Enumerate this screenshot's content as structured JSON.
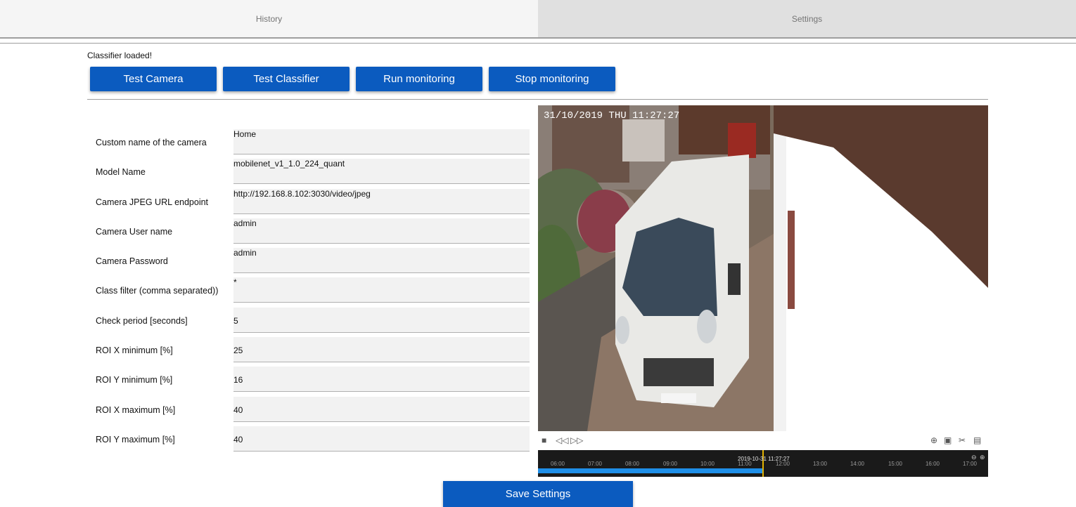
{
  "tabs": {
    "history": "History",
    "settings": "Settings"
  },
  "status": "Classifier loaded!",
  "buttons": {
    "test_camera": "Test Camera",
    "test_classifier": "Test Classifier",
    "run_monitoring": "Run monitoring",
    "stop_monitoring": "Stop monitoring",
    "save_settings": "Save Settings"
  },
  "form": [
    {
      "label": "Custom name of the camera",
      "value": "Home"
    },
    {
      "label": "Model Name",
      "value": "mobilenet_v1_1.0_224_quant"
    },
    {
      "label": "Camera JPEG URL endpoint",
      "value": "http://192.168.8.102:3030/video/jpeg"
    },
    {
      "label": "Camera User name",
      "value": "admin"
    },
    {
      "label": "Camera Password",
      "value": "admin"
    },
    {
      "label": "Class filter (comma separated))",
      "value": "*"
    },
    {
      "label": "Check period [seconds]",
      "value": "5"
    },
    {
      "label": "ROI X minimum [%]",
      "value": "25"
    },
    {
      "label": "ROI Y minimum [%]",
      "value": "16"
    },
    {
      "label": "ROI X maximum [%]",
      "value": "40"
    },
    {
      "label": "ROI Y maximum [%]",
      "value": "40"
    }
  ],
  "camera": {
    "osd": "31/10/2019  THU  11:27:27",
    "timeline_stamp": "2019-10-31 11:27:27",
    "hours": [
      "06:00",
      "07:00",
      "08:00",
      "09:00",
      "10:00",
      "11:00",
      "12:00",
      "13:00",
      "14:00",
      "15:00",
      "16:00",
      "17:00"
    ]
  },
  "colors": {
    "button": "#0b5bbf",
    "timeline_bar": "#1f8fe8",
    "timeline_cursor": "#e2b200"
  },
  "icons": [
    "stop-icon",
    "prev-frame-icon",
    "next-frame-icon",
    "zoom-icon",
    "snapshot-icon",
    "clip-icon",
    "download-icon",
    "zoom-out-icon",
    "zoom-in-icon"
  ]
}
